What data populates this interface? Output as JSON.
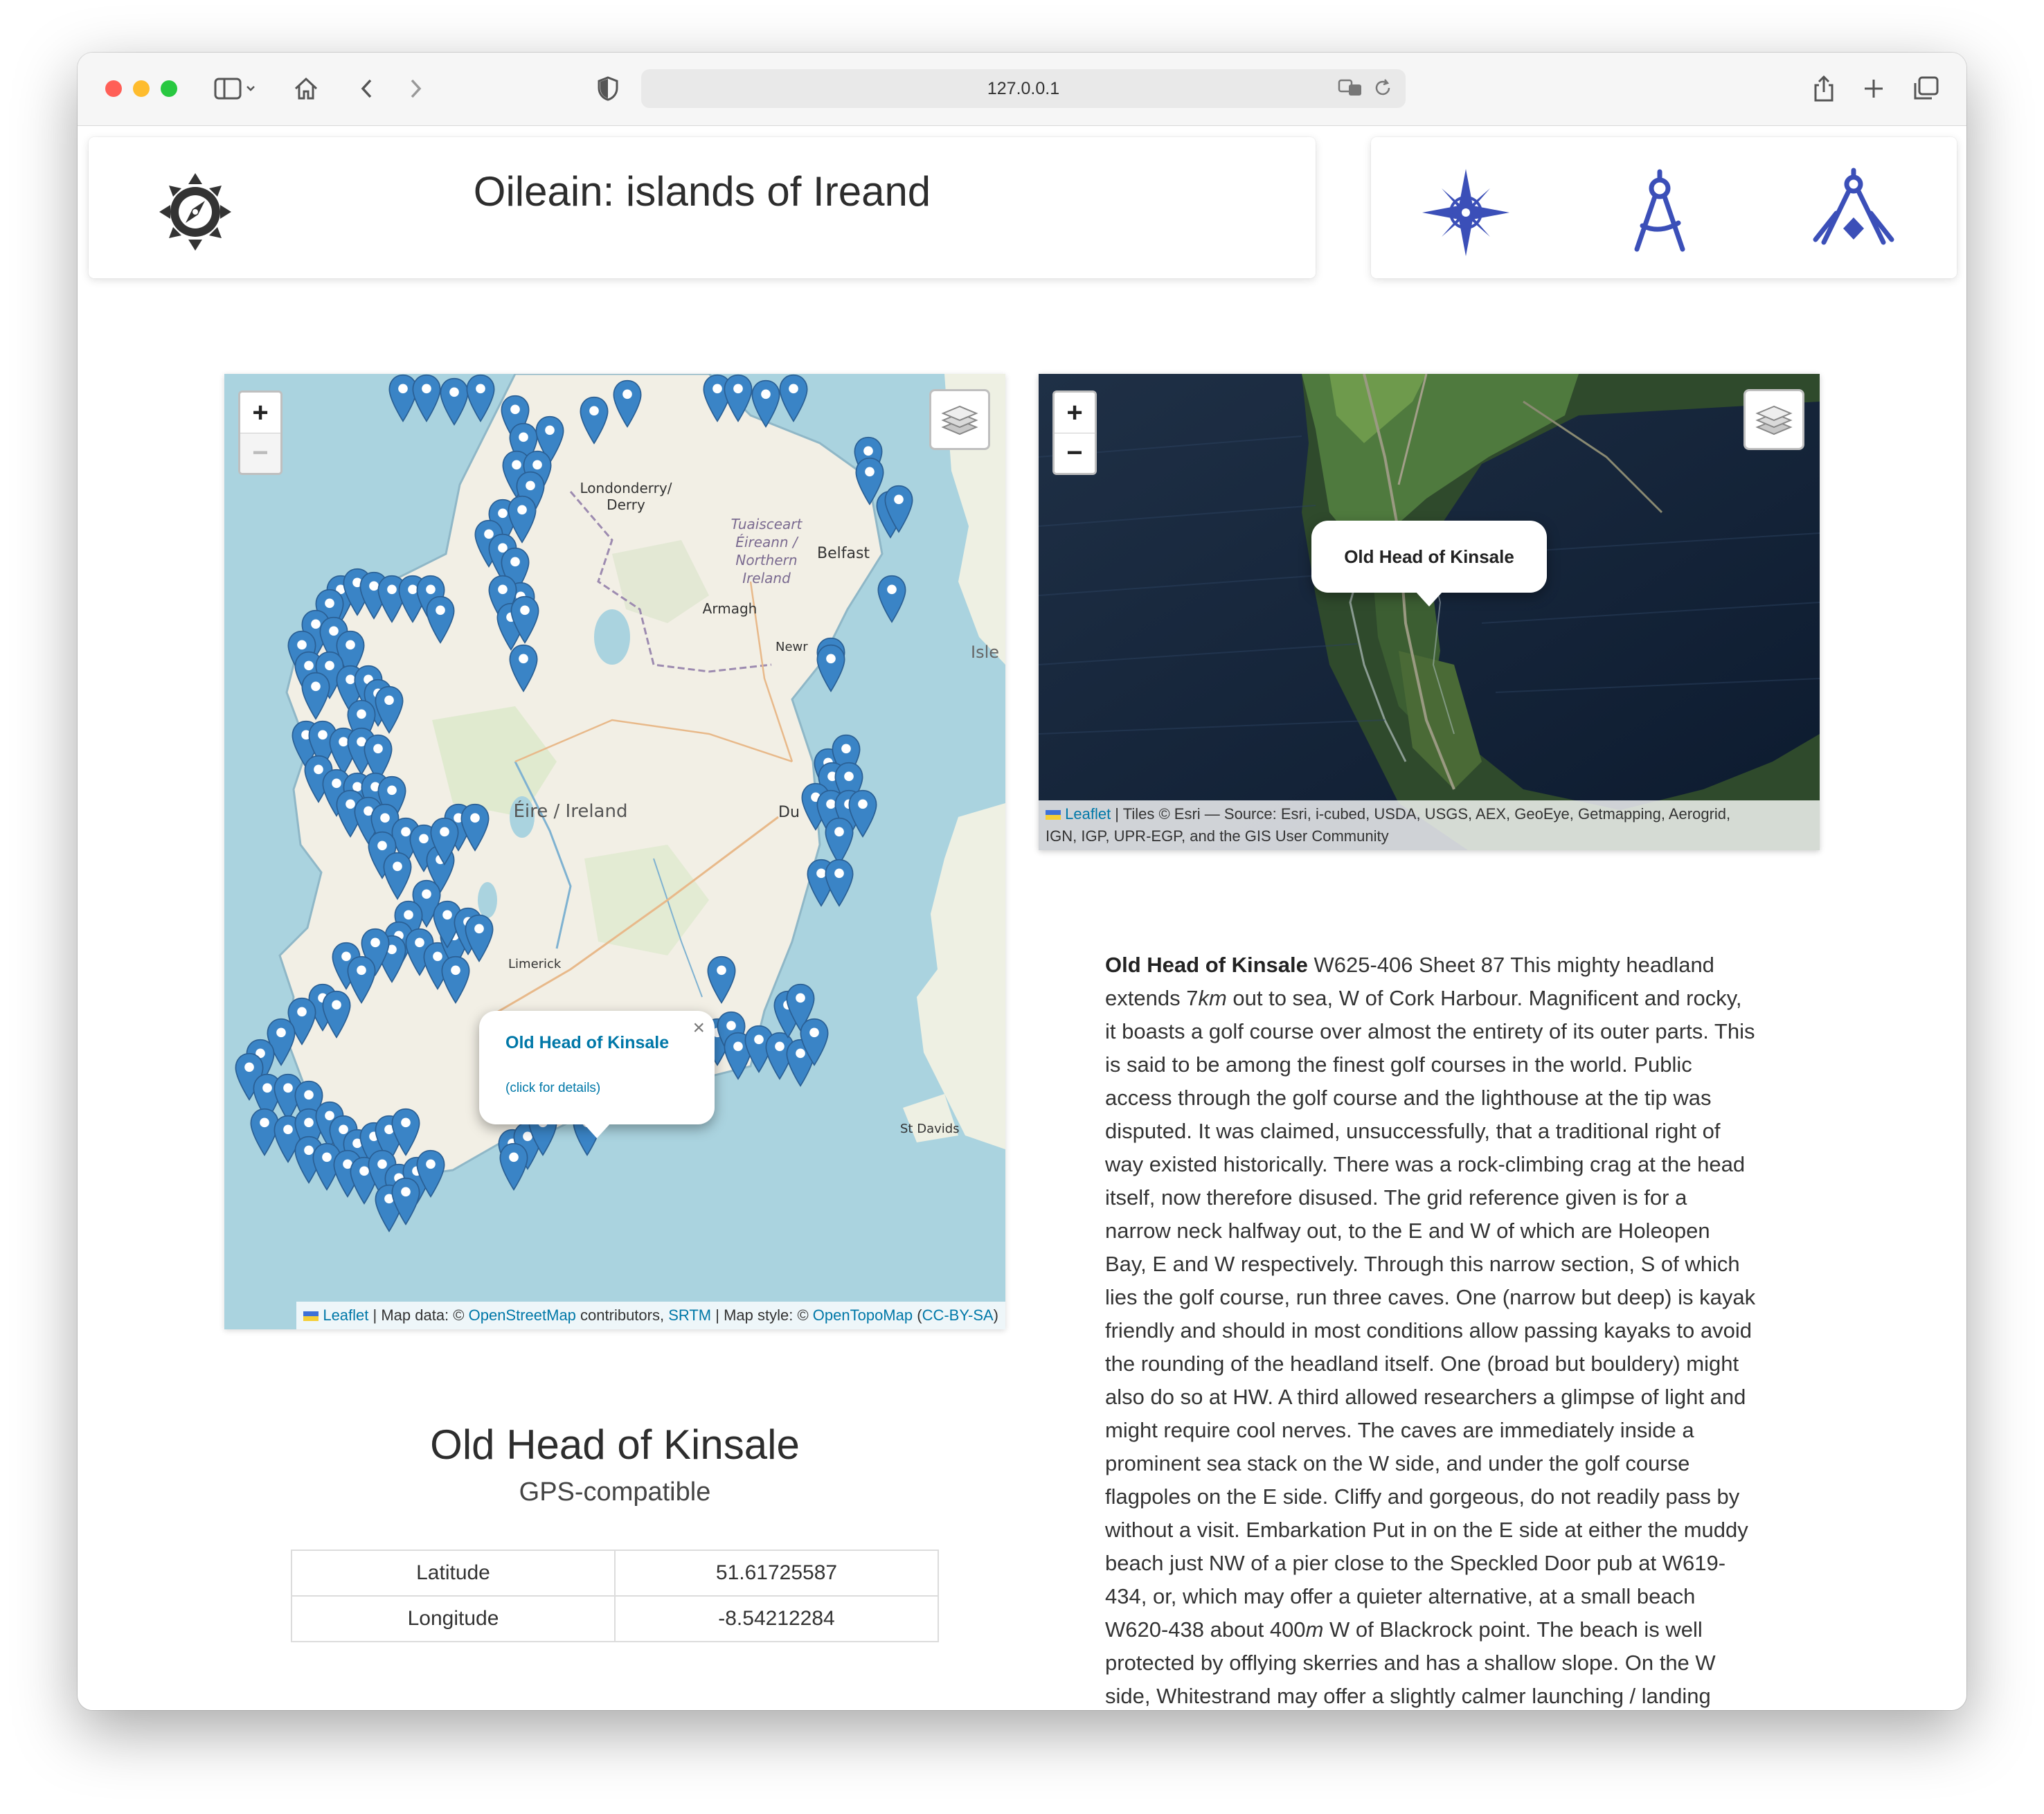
{
  "browser": {
    "url": "127.0.0.1"
  },
  "header": {
    "title": "Oileain: islands of Ireand"
  },
  "map_left": {
    "zoom_in": "+",
    "zoom_out": "−",
    "labels": {
      "derry": "Londonderry/",
      "derry2": "Derry",
      "belfast": "Belfast",
      "ni1": "Tuaisceart",
      "ni2": "Éireann /",
      "ni3": "Northern",
      "ni4": "Ireland",
      "armagh": "Armagh",
      "newry": "Newr",
      "isle": "Isle",
      "ireland": "Éire / Ireland",
      "dublin": "Du",
      "limerick": "Limerick",
      "stdavids": "St Davids"
    },
    "popup": {
      "title": "Old Head of Kinsale",
      "link": "(click for details)",
      "close": "×"
    },
    "attribution": {
      "leaflet": "Leaflet",
      "t1": " | Map data: © ",
      "osm": "OpenStreetMap",
      "t2": " contributors, ",
      "srtm": "SRTM",
      "t3": " | Map style: © ",
      "otm": "OpenTopoMap",
      "t4": " (",
      "cc": "CC-BY-SA",
      "t5": ")"
    }
  },
  "map_right": {
    "zoom_in": "+",
    "zoom_out": "−",
    "popup": {
      "title": "Old Head of Kinsale"
    },
    "attribution": {
      "leaflet": "Leaflet",
      "line1": " | Tiles © Esri — Source: Esri, i-cubed, USDA, USGS, AEX, GeoEye, Getmapping, Aerogrid,",
      "line2": "IGN, IGP, UPR-EGP, and the GIS User Community"
    }
  },
  "location": {
    "name": "Old Head of Kinsale",
    "subtitle": "GPS-compatible",
    "coords": [
      {
        "label": "Latitude",
        "value": "51.61725587"
      },
      {
        "label": "Longitude",
        "value": "-8.54212284"
      }
    ]
  },
  "description": {
    "name": "Old Head of Kinsale",
    "p1": " W625-406 Sheet 87 This mighty headland extends 7",
    "km": "km",
    "p2": " out to sea, W of Cork Harbour. Magnificent and rocky, it boasts a golf course over almost the entirety of its outer parts. This is said to be among the finest golf courses in the world. Public access through the golf course and the lighthouse at the tip was disputed. It was claimed, unsuccessfully, that a traditional right of way existed historically. There was a rock-climbing crag at the head itself, now therefore disused. The grid reference given is for a narrow neck halfway out, to the E and W of which are Holeopen Bay, E and W respectively. Through this narrow section, S of which lies the golf course, run three caves. One (narrow but deep) is kayak friendly and should in most conditions allow passing kayaks to avoid the rounding of the headland itself. One (broad but bouldery) might also do so at HW. A third allowed researchers a glimpse of light and might require cool nerves. The caves are immediately inside a prominent sea stack on the W side, and under the golf course flagpoles on the E side. Cliffy and gorgeous, do not readily pass by without a visit. Embarkation Put in on the E side at either the muddy beach just NW of a pier close to the Speckled Door pub at W619-434, or, which may offer a quieter alternative, at a small beach W620-438 about 400",
    "m": "m",
    "p3": " W of Blackrock point. The beach is well protected by offlying skerries and has a shallow slope. On the W side, Whitestrand may offer a slightly calmer launching / landing place than Garretstown beach. It is a sandy"
  },
  "colors": {
    "accent": "#3b4fb8",
    "marker": "#3a84c6",
    "link": "#0078a8"
  },
  "icons": {
    "logo": "compass-gear-icon",
    "tool1": "compass-rose-icon",
    "tool2": "drafting-compass-icon",
    "tool3": "compass-square-icon"
  }
}
